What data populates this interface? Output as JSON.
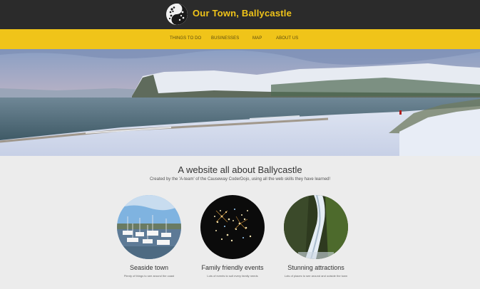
{
  "header": {
    "site_title": "Our Town, Ballycastle",
    "logo_icon": "yin-yang-dots-icon",
    "background": "#2b2b2b",
    "title_color": "#f0c419"
  },
  "nav": {
    "background": "#f0c419",
    "items": [
      {
        "label": "THINGS TO DO"
      },
      {
        "label": "BUSINESSES"
      },
      {
        "label": "MAP"
      },
      {
        "label": "ABOUT US"
      }
    ]
  },
  "hero": {
    "image": "snowy-beach-headland-photo"
  },
  "intro": {
    "headline": "A website all about Ballycastle",
    "subline": "Created by the 'A-team' of the Causeway CoderDojo, using all the web skills they have learned!"
  },
  "features": [
    {
      "title": "Seaside town",
      "description": "Plenty of things to see around the coast",
      "image": "harbour-boats-photo"
    },
    {
      "title": "Family friendly events",
      "description": "Lots of events to suit every family needs",
      "image": "fireworks-photo"
    },
    {
      "title": "Stunning attractions",
      "description": "Lots of places to see around and outside the town",
      "image": "waterfall-photo"
    }
  ]
}
